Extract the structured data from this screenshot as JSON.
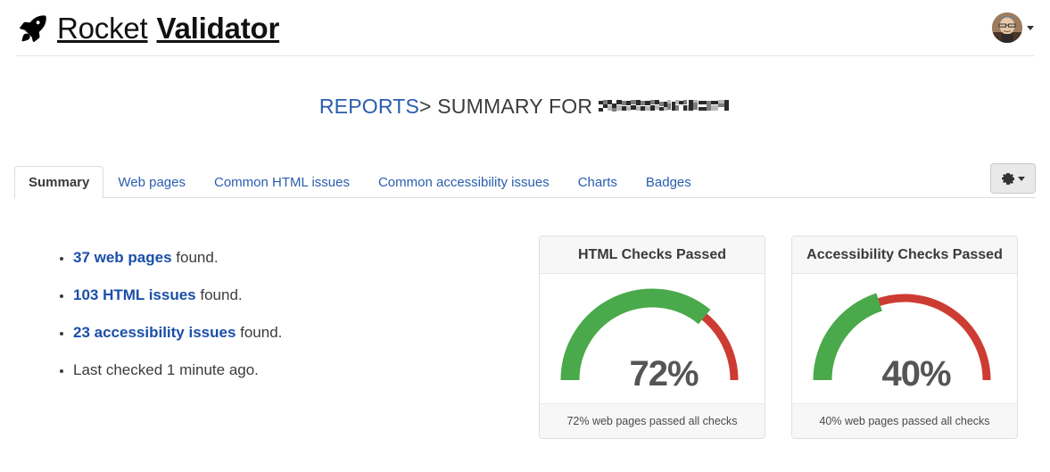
{
  "header": {
    "brand_light": "Rocket",
    "brand_bold": "Validator",
    "rocket_icon": "rocket-icon",
    "avatar_alt": "user-avatar",
    "user_caret": "caret-down-icon"
  },
  "breadcrumb": {
    "reports_link": "REPORTS",
    "separator": ">",
    "label": "SUMMARY FOR",
    "site_name_redacted": true
  },
  "tabs": [
    {
      "label": "Summary",
      "active": true
    },
    {
      "label": "Web pages",
      "active": false
    },
    {
      "label": "Common HTML issues",
      "active": false
    },
    {
      "label": "Common accessibility issues",
      "active": false
    },
    {
      "label": "Charts",
      "active": false
    },
    {
      "label": "Badges",
      "active": false
    }
  ],
  "settings_button": {
    "icon": "gear-icon",
    "caret": "caret-down-icon"
  },
  "summary": {
    "items": [
      {
        "link": "37 web pages",
        "rest": " found."
      },
      {
        "link": "103 HTML issues",
        "rest": " found."
      },
      {
        "link": "23 accessibility issues",
        "rest": " found."
      },
      {
        "link": "",
        "rest": "Last checked 1 minute ago."
      }
    ]
  },
  "colors": {
    "green": "#4aa94a",
    "red": "#cd3c32",
    "link_blue": "#2a5db0",
    "value_grey": "#555555"
  },
  "chart_data": [
    {
      "type": "gauge",
      "title": "HTML Checks Passed",
      "value": 72,
      "unit": "%",
      "value_label": "72%",
      "min": 0,
      "max": 100,
      "passed_color": "#4aa94a",
      "remaining_color": "#cd3c32",
      "footer": "72% web pages passed all checks"
    },
    {
      "type": "gauge",
      "title": "Accessibility Checks Passed",
      "value": 40,
      "unit": "%",
      "value_label": "40%",
      "min": 0,
      "max": 100,
      "passed_color": "#4aa94a",
      "remaining_color": "#cd3c32",
      "footer": "40% web pages passed all checks"
    }
  ]
}
